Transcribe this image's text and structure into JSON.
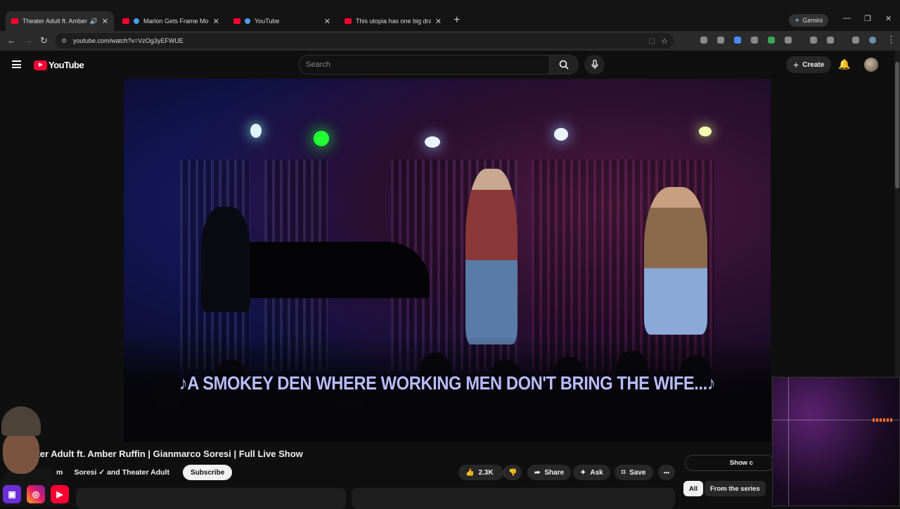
{
  "browser": {
    "tabs": [
      {
        "title": "Theater Adult ft. Amber Ru",
        "favicon": "youtube-icon",
        "active": true
      },
      {
        "title": "Marlon Gets Frame Mogge",
        "favicon": "youtube-icon",
        "active": false
      },
      {
        "title": "YouTube",
        "favicon": "youtube-icon",
        "active": false
      },
      {
        "title": "This utopia has one big drawba",
        "favicon": "youtube-icon",
        "active": false
      }
    ],
    "gemini_label": "Gemini",
    "url": "youtube.com/watch?v=VzOg3yEFWUE"
  },
  "header": {
    "logo_text": "YouTube",
    "search_placeholder": "Search",
    "create_label": "Create"
  },
  "video": {
    "subtitle": "♪A SMOKEY DEN WHERE WORKING MEN DON'T BRING THE WIFE...♪",
    "title": "eater Adult ft. Amber Ruffin | Gianmarco Soresi | Full Live Show",
    "channel_fragment": "m",
    "channel_names": "Soresi ✓ and Theater Adult"
  },
  "actions": {
    "subscribe": "Subscribe",
    "likes": "2.3K",
    "share": "Share",
    "ask": "Ask",
    "save": "Save",
    "more": "•••"
  },
  "sidebar": {
    "show_label": "Show c",
    "chips": [
      "All",
      "From the series"
    ]
  },
  "colors": {
    "brand_red": "#ff0033",
    "subtitle": "#b8bcff",
    "background": "#0f0f0f"
  }
}
